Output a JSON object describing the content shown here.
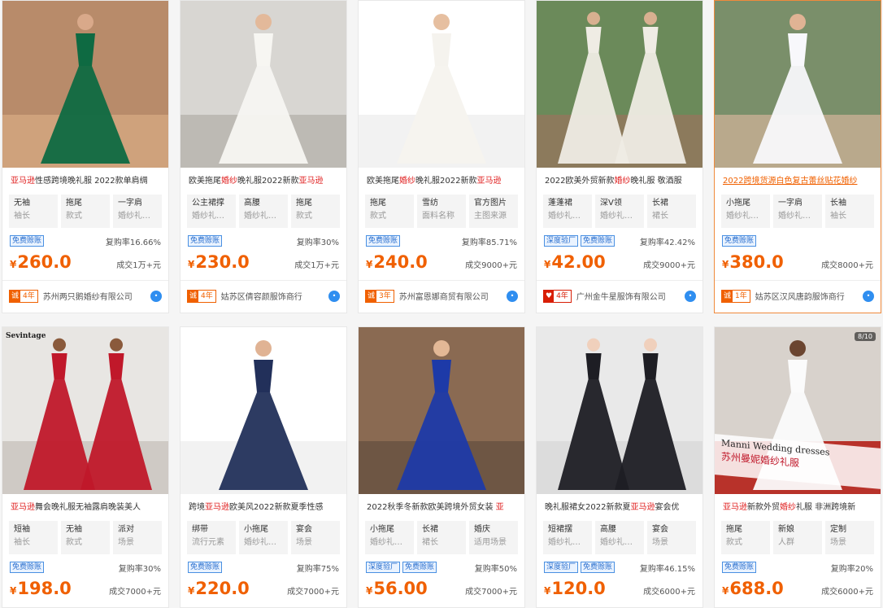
{
  "products": [
    {
      "title_parts": [
        {
          "t": "亚马逊",
          "hl": true
        },
        {
          "t": "性感跨境晚礼服 2022款单肩绸",
          "hl": false
        }
      ],
      "attrs": [
        {
          "v": "无袖",
          "k": "袖长"
        },
        {
          "v": "拖尾",
          "k": "款式"
        },
        {
          "v": "一字肩",
          "k": "婚纱礼…"
        }
      ],
      "tags": [
        "免费赊账"
      ],
      "rate": "复购率16.66%",
      "currency": "¥",
      "price": "260.0",
      "deal": "成交1万+元",
      "badge_icon": "诚",
      "years": "4年",
      "shop": "苏州两只鹅婚纱有限公司",
      "image": {
        "bg": "#b88b6a",
        "floor": "#cfa27c",
        "dress": "#0e6a42",
        "skin": "#d9a98a"
      }
    },
    {
      "title_parts": [
        {
          "t": "欧美拖尾",
          "hl": false
        },
        {
          "t": "婚纱",
          "hl": true
        },
        {
          "t": "晚礼服2022新款",
          "hl": false
        },
        {
          "t": "亚马逊",
          "hl": true
        }
      ],
      "attrs": [
        {
          "v": "公主裙撑",
          "k": "婚纱礼…"
        },
        {
          "v": "高腰",
          "k": "婚纱礼…"
        },
        {
          "v": "拖尾",
          "k": "款式"
        }
      ],
      "tags": [
        "免费赊账"
      ],
      "rate": "复购率30%",
      "currency": "¥",
      "price": "230.0",
      "deal": "成交1万+元",
      "badge_icon": "诚",
      "years": "4年",
      "shop": "姑苏区倩容颜服饰商行",
      "image": {
        "bg": "#d8d6d2",
        "floor": "#bdbab4",
        "dress": "#f7f6f2",
        "skin": "#e3b99a"
      }
    },
    {
      "title_parts": [
        {
          "t": "欧美拖尾",
          "hl": false
        },
        {
          "t": "婚纱",
          "hl": true
        },
        {
          "t": "晚礼服2022新款",
          "hl": false
        },
        {
          "t": "亚马逊",
          "hl": true
        }
      ],
      "attrs": [
        {
          "v": "拖尾",
          "k": "款式"
        },
        {
          "v": "雪纺",
          "k": "面料名称"
        },
        {
          "v": "官方图片",
          "k": "主图来源"
        }
      ],
      "tags": [
        "免费赊账"
      ],
      "rate": "复购率85.71%",
      "currency": "¥",
      "price": "240.0",
      "deal": "成交9000+元",
      "badge_icon": "诚",
      "years": "3年",
      "shop": "苏州富恩娜商贸有限公司",
      "image": {
        "bg": "#ffffff",
        "floor": "#f2f2f2",
        "dress": "#f5f3ee",
        "skin": "#e6bfa0"
      }
    },
    {
      "title_parts": [
        {
          "t": "2022欧美外贸新款",
          "hl": false
        },
        {
          "t": "婚纱",
          "hl": true
        },
        {
          "t": "晚礼服 敬酒服",
          "hl": false
        }
      ],
      "attrs": [
        {
          "v": "蓬蓬裙",
          "k": "婚纱礼…"
        },
        {
          "v": "深V领",
          "k": "婚纱礼…"
        },
        {
          "v": "长裙",
          "k": "裙长"
        }
      ],
      "tags": [
        "深度验厂",
        "免费赊账"
      ],
      "rate": "复购率42.42%",
      "currency": "¥",
      "price": "42.00",
      "deal": "成交9000+元",
      "badge_icon": "♥",
      "years": "4年",
      "shop": "广州金牛星服饰有限公司",
      "badge_red": true,
      "image": {
        "bg": "#6b8a5a",
        "floor": "#8c7a5c",
        "dress": "#efece4",
        "skin": "#d8b090"
      }
    },
    {
      "title_parts": [
        {
          "t": "2022跨境货源白色复古蕾丝贴花婚纱",
          "hl": false
        }
      ],
      "attrs": [
        {
          "v": "小拖尾",
          "k": "婚纱礼…"
        },
        {
          "v": "一字肩",
          "k": "婚纱礼…"
        },
        {
          "v": "长袖",
          "k": "袖长"
        }
      ],
      "tags": [
        "免费赊账"
      ],
      "rate": "",
      "currency": "¥",
      "price": "380.0",
      "deal": "成交8000+元",
      "badge_icon": "诚",
      "years": "1年",
      "shop": "姑苏区汉风唐韵服饰商行",
      "active": true,
      "image": {
        "bg": "#7a8f6a",
        "floor": "#b9a98c",
        "dress": "#f8f8fb",
        "skin": "#e0b394"
      }
    },
    {
      "title_parts": [
        {
          "t": "亚马逊",
          "hl": true
        },
        {
          "t": "舞会晚礼服无袖露肩晚装美人",
          "hl": false
        }
      ],
      "attrs": [
        {
          "v": "短袖",
          "k": "袖长"
        },
        {
          "v": "无袖",
          "k": "款式"
        },
        {
          "v": "派对",
          "k": "场景"
        }
      ],
      "tags": [
        "免费赊账"
      ],
      "rate": "复购率30%",
      "currency": "¥",
      "price": "198.0",
      "deal": "成交7000+元",
      "image_label": "Sevintage",
      "image": {
        "bg": "#e8e6e3",
        "floor": "#cfcac5",
        "dress": "#c0182a",
        "skin": "#8a5a3c"
      }
    },
    {
      "title_parts": [
        {
          "t": "跨境",
          "hl": false
        },
        {
          "t": "亚马逊",
          "hl": true
        },
        {
          "t": "欧美风2022新款夏季性感",
          "hl": false
        }
      ],
      "attrs": [
        {
          "v": "绑带",
          "k": "流行元素"
        },
        {
          "v": "小拖尾",
          "k": "婚纱礼…"
        },
        {
          "v": "宴会",
          "k": "场景"
        }
      ],
      "tags": [
        "免费赊账"
      ],
      "rate": "复购率75%",
      "currency": "¥",
      "price": "220.0",
      "deal": "成交7000+元",
      "image": {
        "bg": "#ffffff",
        "floor": "#f2f2f2",
        "dress": "#22305a",
        "skin": "#e0b394"
      }
    },
    {
      "title_parts": [
        {
          "t": "2022秋季冬新款欧美跨境外贸女装 ",
          "hl": false
        },
        {
          "t": "亚",
          "hl": true
        }
      ],
      "attrs": [
        {
          "v": "小拖尾",
          "k": "婚纱礼…"
        },
        {
          "v": "长裙",
          "k": "裙长"
        },
        {
          "v": "婚庆",
          "k": "适用场景"
        }
      ],
      "tags": [
        "深度验厂",
        "免费赊账"
      ],
      "rate": "复购率50%",
      "currency": "¥",
      "price": "56.00",
      "deal": "成交7000+元",
      "image": {
        "bg": "#8a6a52",
        "floor": "#6e5644",
        "dress": "#1d3aa8",
        "skin": "#e3b896"
      }
    },
    {
      "title_parts": [
        {
          "t": "晚礼服裙女2022新款夏",
          "hl": false
        },
        {
          "t": "亚马逊",
          "hl": true
        },
        {
          "t": "宴会优",
          "hl": false
        }
      ],
      "attrs": [
        {
          "v": "短裙摆",
          "k": "婚纱礼…"
        },
        {
          "v": "高腰",
          "k": "婚纱礼…"
        },
        {
          "v": "宴会",
          "k": "场景"
        }
      ],
      "tags": [
        "深度验厂",
        "免费赊账"
      ],
      "rate": "复购率46.15%",
      "currency": "¥",
      "price": "120.0",
      "deal": "成交6000+元",
      "image": {
        "bg": "#e9e9e9",
        "floor": "#dcdcdc",
        "dress": "#1e1e24",
        "skin": "#f0d0bc"
      }
    },
    {
      "title_parts": [
        {
          "t": "亚马逊",
          "hl": true
        },
        {
          "t": "新款外贸",
          "hl": false
        },
        {
          "t": "婚纱",
          "hl": true
        },
        {
          "t": "礼服 非洲跨境新",
          "hl": false
        }
      ],
      "attrs": [
        {
          "v": "拖尾",
          "k": "款式"
        },
        {
          "v": "新娘",
          "k": "人群"
        },
        {
          "v": "定制",
          "k": "场景"
        }
      ],
      "tags": [
        "免费赊账"
      ],
      "rate": "复购率20%",
      "currency": "¥",
      "price": "688.0",
      "deal": "成交6000+元",
      "image_counter": "8/10",
      "image_text": "Manni Wedding dresses",
      "image_text2": "苏州曼妮婚纱礼服",
      "image": {
        "bg": "#d8d2cc",
        "floor": "#b8322a",
        "dress": "#fbfbfb",
        "skin": "#6b4530"
      }
    }
  ],
  "colors": {
    "accent": "#f06000",
    "highlight": "#e02020",
    "tag": "#2a6fce",
    "border_active": "#f08a3c"
  }
}
